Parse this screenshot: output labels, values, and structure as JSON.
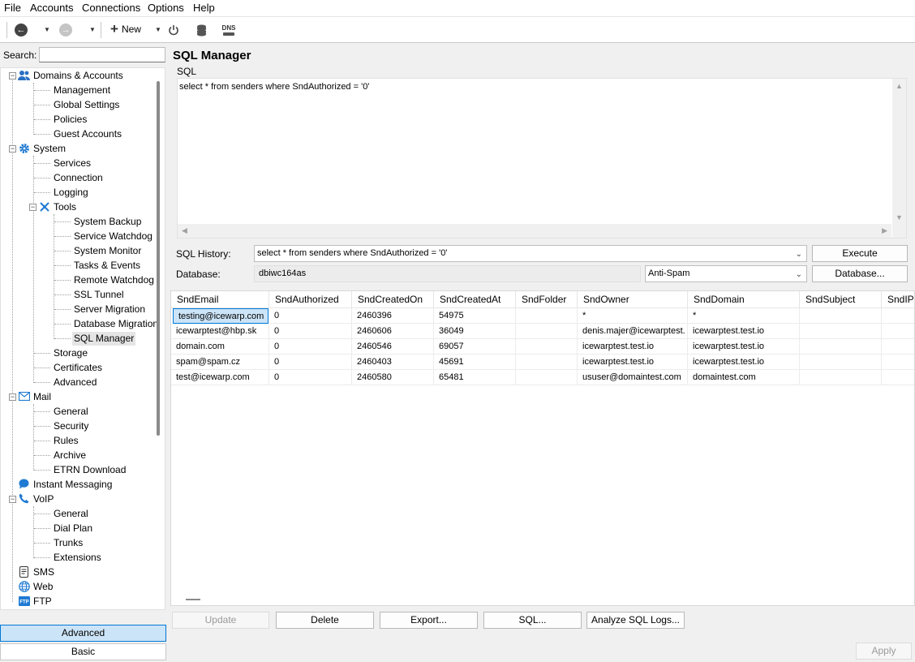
{
  "menu": [
    "File",
    "Accounts",
    "Connections",
    "Options",
    "Help"
  ],
  "toolbar": {
    "new_label": "New",
    "dns_label": "DNS"
  },
  "search": {
    "label": "Search:",
    "value": ""
  },
  "tree": {
    "domains": "Domains & Accounts",
    "management": "Management",
    "global_settings": "Global Settings",
    "policies": "Policies",
    "guest_accounts": "Guest Accounts",
    "system": "System",
    "services": "Services",
    "connection": "Connection",
    "logging": "Logging",
    "tools": "Tools",
    "system_backup": "System Backup",
    "service_watchdog": "Service Watchdog",
    "system_monitor": "System Monitor",
    "tasks_events": "Tasks & Events",
    "remote_watchdog": "Remote Watchdog",
    "ssl_tunnel": "SSL Tunnel",
    "server_migration": "Server Migration",
    "database_migration": "Database Migration",
    "sql_manager": "SQL Manager",
    "storage": "Storage",
    "certificates": "Certificates",
    "advanced": "Advanced",
    "mail": "Mail",
    "mail_general": "General",
    "mail_security": "Security",
    "mail_rules": "Rules",
    "mail_archive": "Archive",
    "mail_etrn": "ETRN Download",
    "instant_messaging": "Instant Messaging",
    "voip": "VoIP",
    "voip_general": "General",
    "voip_dialplan": "Dial Plan",
    "voip_trunks": "Trunks",
    "voip_extensions": "Extensions",
    "sms": "SMS",
    "web": "Web",
    "ftp": "FTP"
  },
  "mode": {
    "advanced": "Advanced",
    "basic": "Basic"
  },
  "main": {
    "title": "SQL Manager",
    "sql_label": "SQL",
    "sql_text": "select * from senders where SndAuthorized = '0'",
    "history_label": "SQL History:",
    "history_value": "select * from senders where SndAuthorized = '0'",
    "execute": "Execute",
    "database_label": "Database:",
    "database_value": "dbiwc164as",
    "database_type": "Anti-Spam",
    "database_btn": "Database..."
  },
  "grid": {
    "columns": [
      "SndEmail",
      "SndAuthorized",
      "SndCreatedOn",
      "SndCreatedAt",
      "SndFolder",
      "SndOwner",
      "SndDomain",
      "SndSubject",
      "SndIP"
    ],
    "rows": [
      [
        "testing@icewarp.com",
        "0",
        "2460396",
        "54975",
        "",
        "*",
        "*",
        "",
        ""
      ],
      [
        "icewarptest@hbp.sk",
        "0",
        "2460606",
        "36049",
        "",
        "denis.majer@icewarptest.",
        "icewarptest.test.io",
        "",
        ""
      ],
      [
        "domain.com",
        "0",
        "2460546",
        "69057",
        "",
        "icewarptest.test.io",
        "icewarptest.test.io",
        "",
        ""
      ],
      [
        "spam@spam.cz",
        "0",
        "2460403",
        "45691",
        "",
        "icewarptest.test.io",
        "icewarptest.test.io",
        "",
        ""
      ],
      [
        "test@icewarp.com",
        "0",
        "2460580",
        "65481",
        "",
        "ususer@domaintest.com",
        "domaintest.com",
        "",
        ""
      ]
    ]
  },
  "buttons": {
    "update": "Update",
    "delete": "Delete",
    "export": "Export...",
    "sql": "SQL...",
    "analyze": "Analyze SQL Logs...",
    "apply": "Apply"
  }
}
